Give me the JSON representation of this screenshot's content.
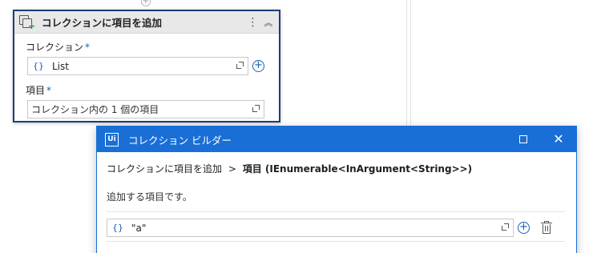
{
  "activity": {
    "title": "コレクションに項目を追加",
    "collection_label": "コレクション",
    "collection_value": "List",
    "item_label": "項目",
    "item_placeholder": "コレクション内の 1 個の項目",
    "required_mark": "*"
  },
  "dialog": {
    "title": "コレクション ビルダー",
    "logo": "Ui",
    "breadcrumb_parent": "コレクションに項目を追加",
    "breadcrumb_sep": ">",
    "breadcrumb_current": "項目 (IEnumerable<InArgument<String>>)",
    "description": "追加する項目です。",
    "items": [
      {
        "value": "\"a\""
      }
    ]
  },
  "icons": {
    "brace": "{}",
    "add": "+",
    "kebab": "⋮",
    "collapse": "︽",
    "close": "✕"
  }
}
